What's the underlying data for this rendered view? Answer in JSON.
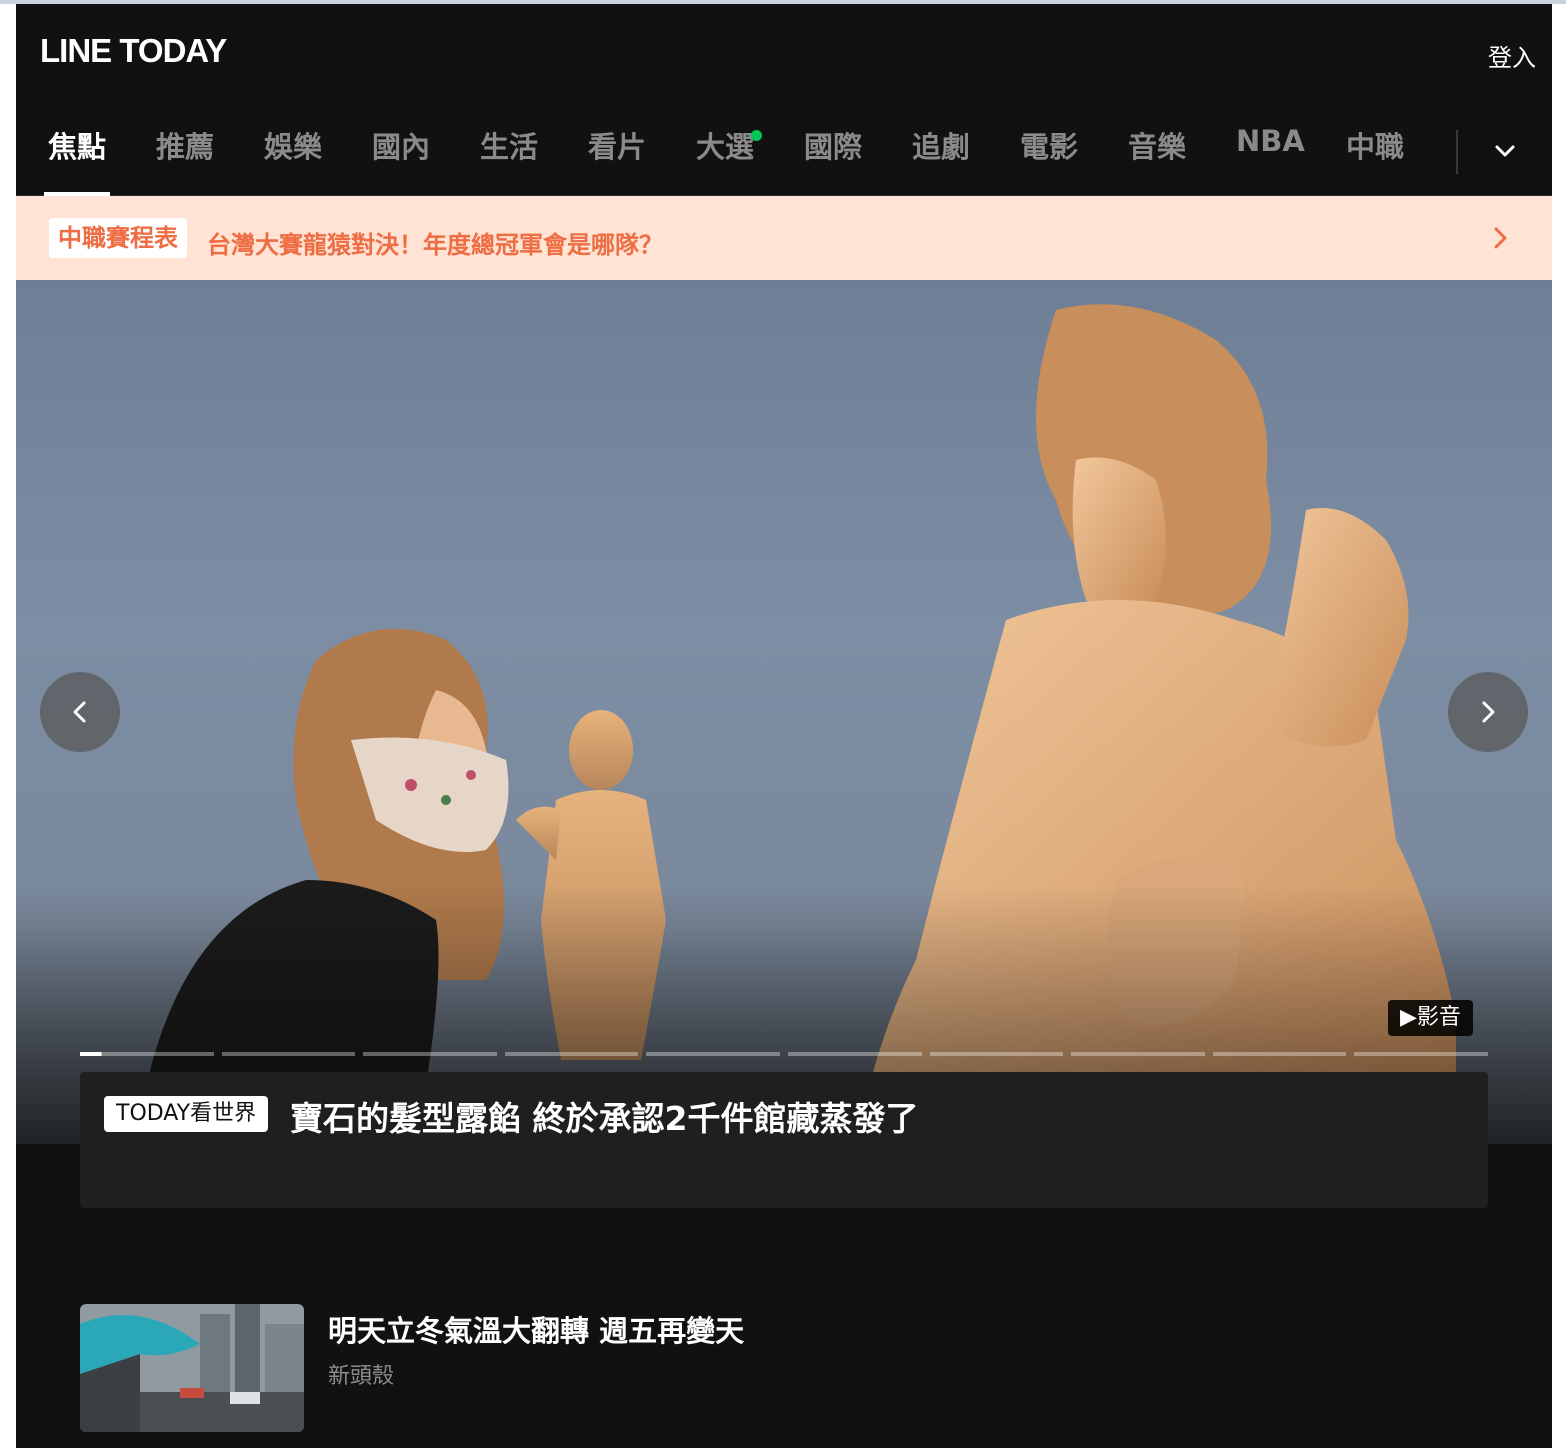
{
  "header": {
    "logo": "LINE TODAY",
    "login_label": "登入"
  },
  "nav": {
    "tabs": [
      {
        "label": "焦點",
        "active": true
      },
      {
        "label": "推薦"
      },
      {
        "label": "娛樂"
      },
      {
        "label": "國內"
      },
      {
        "label": "生活"
      },
      {
        "label": "看片"
      },
      {
        "label": "大選",
        "new_dot": true
      },
      {
        "label": "國際"
      },
      {
        "label": "追劇"
      },
      {
        "label": "電影"
      },
      {
        "label": "音樂"
      },
      {
        "label": "NBA"
      },
      {
        "label": "中職"
      }
    ],
    "more_icon": "chevron-down-icon"
  },
  "banner": {
    "tag": "中職賽程表",
    "text": "台灣大賽龍猿對決！年度總冠軍會是哪隊？",
    "arrow_icon": "chevron-right-icon"
  },
  "hero": {
    "video_badge": "影音",
    "slide_count": 10,
    "current_slide": 1,
    "prev_icon": "chevron-left-icon",
    "next_icon": "chevron-right-icon"
  },
  "headline": {
    "tag": "TODAY看世界",
    "title": "寶石的髮型露餡 終於承認2千件館藏蒸發了"
  },
  "list": [
    {
      "title": "明天立冬氣溫大翻轉 週五再變天",
      "source": "新頭殼"
    }
  ],
  "colors": {
    "background": "#111111",
    "banner_bg": "#ffe4d6",
    "banner_accent": "#ef6d42",
    "new_dot": "#06c755"
  }
}
